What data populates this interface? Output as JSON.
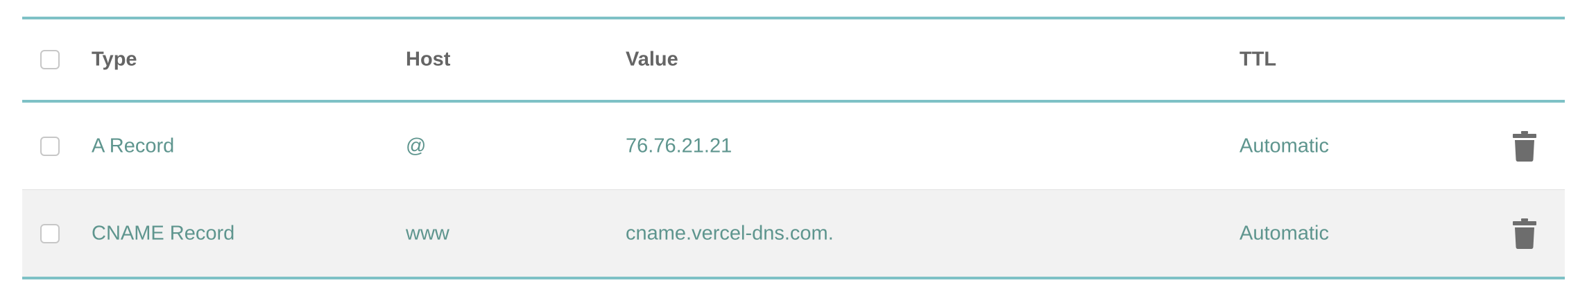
{
  "table": {
    "headers": {
      "type": "Type",
      "host": "Host",
      "value": "Value",
      "ttl": "TTL"
    },
    "records": [
      {
        "type": "A Record",
        "host": "@",
        "value": "76.76.21.21",
        "ttl": "Automatic",
        "checked": false
      },
      {
        "type": "CNAME Record",
        "host": "www",
        "value": "cname.vercel-dns.com.",
        "ttl": "Automatic",
        "checked": false
      }
    ]
  },
  "colors": {
    "accent_border": "#7ec1c6",
    "record_text": "#5e958e",
    "header_text": "#656565",
    "alt_row_bg": "#f2f2f2",
    "trash_icon": "#6d6d6d"
  },
  "icons": {
    "select_all": "checkbox-icon",
    "row_select": "checkbox-icon",
    "delete": "trash-icon"
  }
}
